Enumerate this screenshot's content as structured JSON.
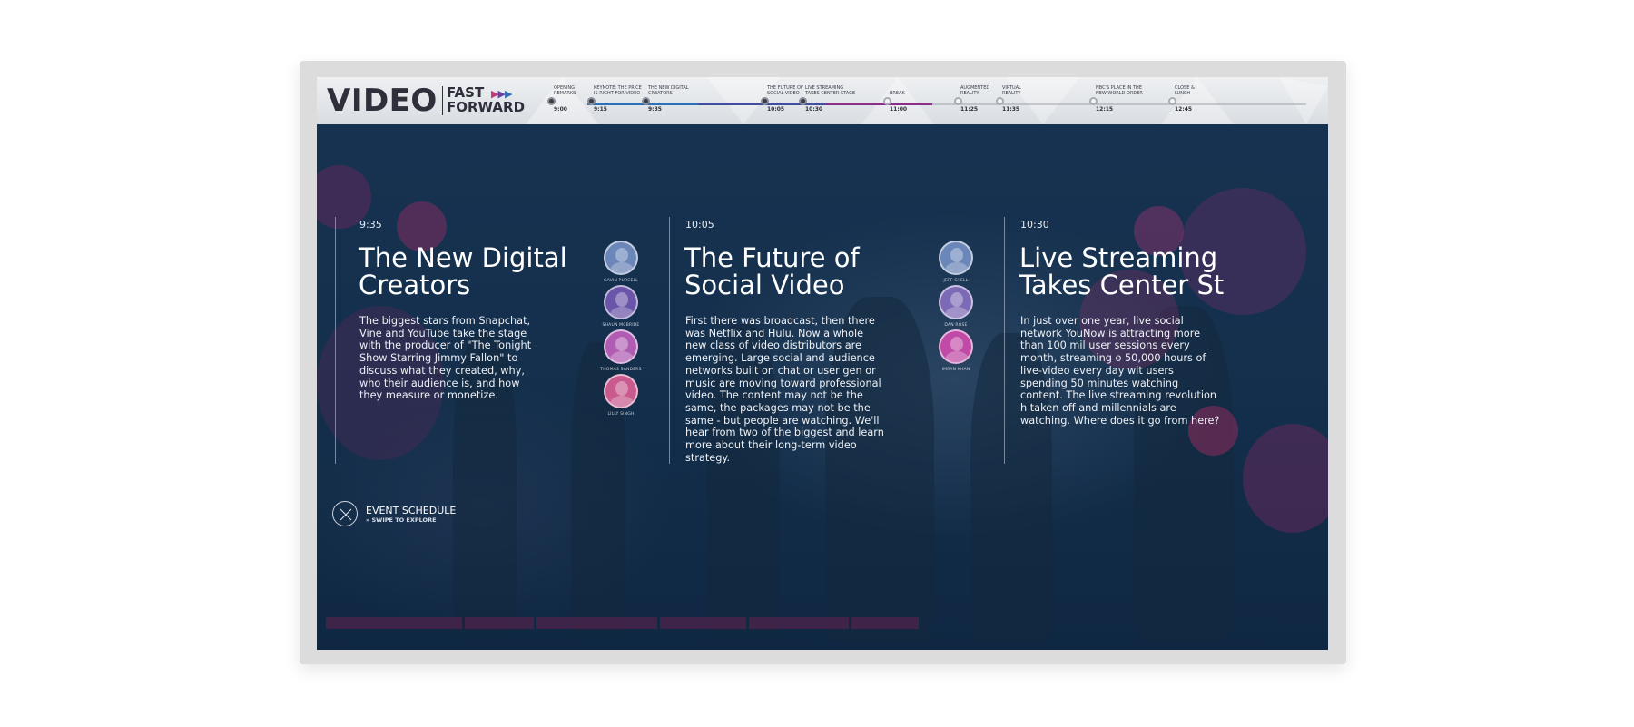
{
  "brand": {
    "word1": "VIDEO",
    "word2_line1": "FAST",
    "word2_line2": "FORWARD",
    "arrows": "▶▶▶"
  },
  "colors": {
    "accent_pink": "#c03a7c",
    "accent_purple": "#6b3fa0",
    "accent_blue": "#2f6fb5",
    "bg_navy": "#14304d"
  },
  "timeline": [
    {
      "label_l1": "OPENING",
      "label_l2": "REMARKS",
      "time": "9:00",
      "state": "past"
    },
    {
      "label_l1": "KEYNOTE: THE PRICE",
      "label_l2": "IS RIGHT FOR VIDEO",
      "time": "9:15",
      "state": "past"
    },
    {
      "label_l1": "THE NEW DIGITAL",
      "label_l2": "CREATORS",
      "time": "9:35",
      "state": "past"
    },
    {
      "label_l1": "THE FUTURE OF",
      "label_l2": "SOCIAL VIDEO",
      "time": "10:05",
      "state": "past"
    },
    {
      "label_l1": "LIVE STREAMING",
      "label_l2": "TAKES CENTER STAGE",
      "time": "10:30",
      "state": "past"
    },
    {
      "label_l1": "BREAK",
      "label_l2": "",
      "time": "11:00",
      "state": "future"
    },
    {
      "label_l1": "AUGMENTED",
      "label_l2": "REALITY",
      "time": "11:25",
      "state": "future"
    },
    {
      "label_l1": "VIRTUAL",
      "label_l2": "REALITY",
      "time": "11:35",
      "state": "future"
    },
    {
      "label_l1": "NBC'S PLACE IN THE",
      "label_l2": "NEW WORLD ORDER",
      "time": "12:15",
      "state": "future"
    },
    {
      "label_l1": "CLOSE &",
      "label_l2": "LUNCH",
      "time": "12:45",
      "state": "future"
    }
  ],
  "sessions": [
    {
      "time": "9:35",
      "title_l1": "The New Digital",
      "title_l2": "Creators",
      "description": "The biggest stars from Snapchat, Vine and YouTube take the stage with the producer of \"The Tonight Show Starring Jimmy Fallon\" to discuss what they created, why, who their audience is, and how they measure or monetize.",
      "speakers": [
        "GAVIN PURCELL",
        "SHAUN MCBRIDE",
        "THOMAS SANDERS",
        "LILLY SINGH"
      ]
    },
    {
      "time": "10:05",
      "title_l1": "The Future of",
      "title_l2": "Social Video",
      "description": "First there was broadcast, then there was Netflix and Hulu.  Now a whole new class of video distributors are emerging.  Large social and audience networks built on chat or user gen or music are moving toward professional video. The content may not be the same, the packages may not be the same - but people are watching. We'll hear from two of the biggest and learn more about their long-term video strategy.",
      "speakers": [
        "JEFF SHELL",
        "DAN ROSE",
        "IMRAN KHAN"
      ]
    },
    {
      "time": "10:30",
      "title_l1": "Live Streaming",
      "title_l2": "Takes Center St",
      "description": "In just over one year, live social network YouNow is attracting more than 100 mil user sessions every month, streaming o 50,000 hours of live-video every day wit users spending 50 minutes watching content. The live streaming revolution h taken off and millennials are watching. Where does it go from here?",
      "speakers": []
    }
  ],
  "schedule": {
    "title": "EVENT SCHEDULE",
    "subtitle": "» SWIPE TO EXPLORE"
  }
}
